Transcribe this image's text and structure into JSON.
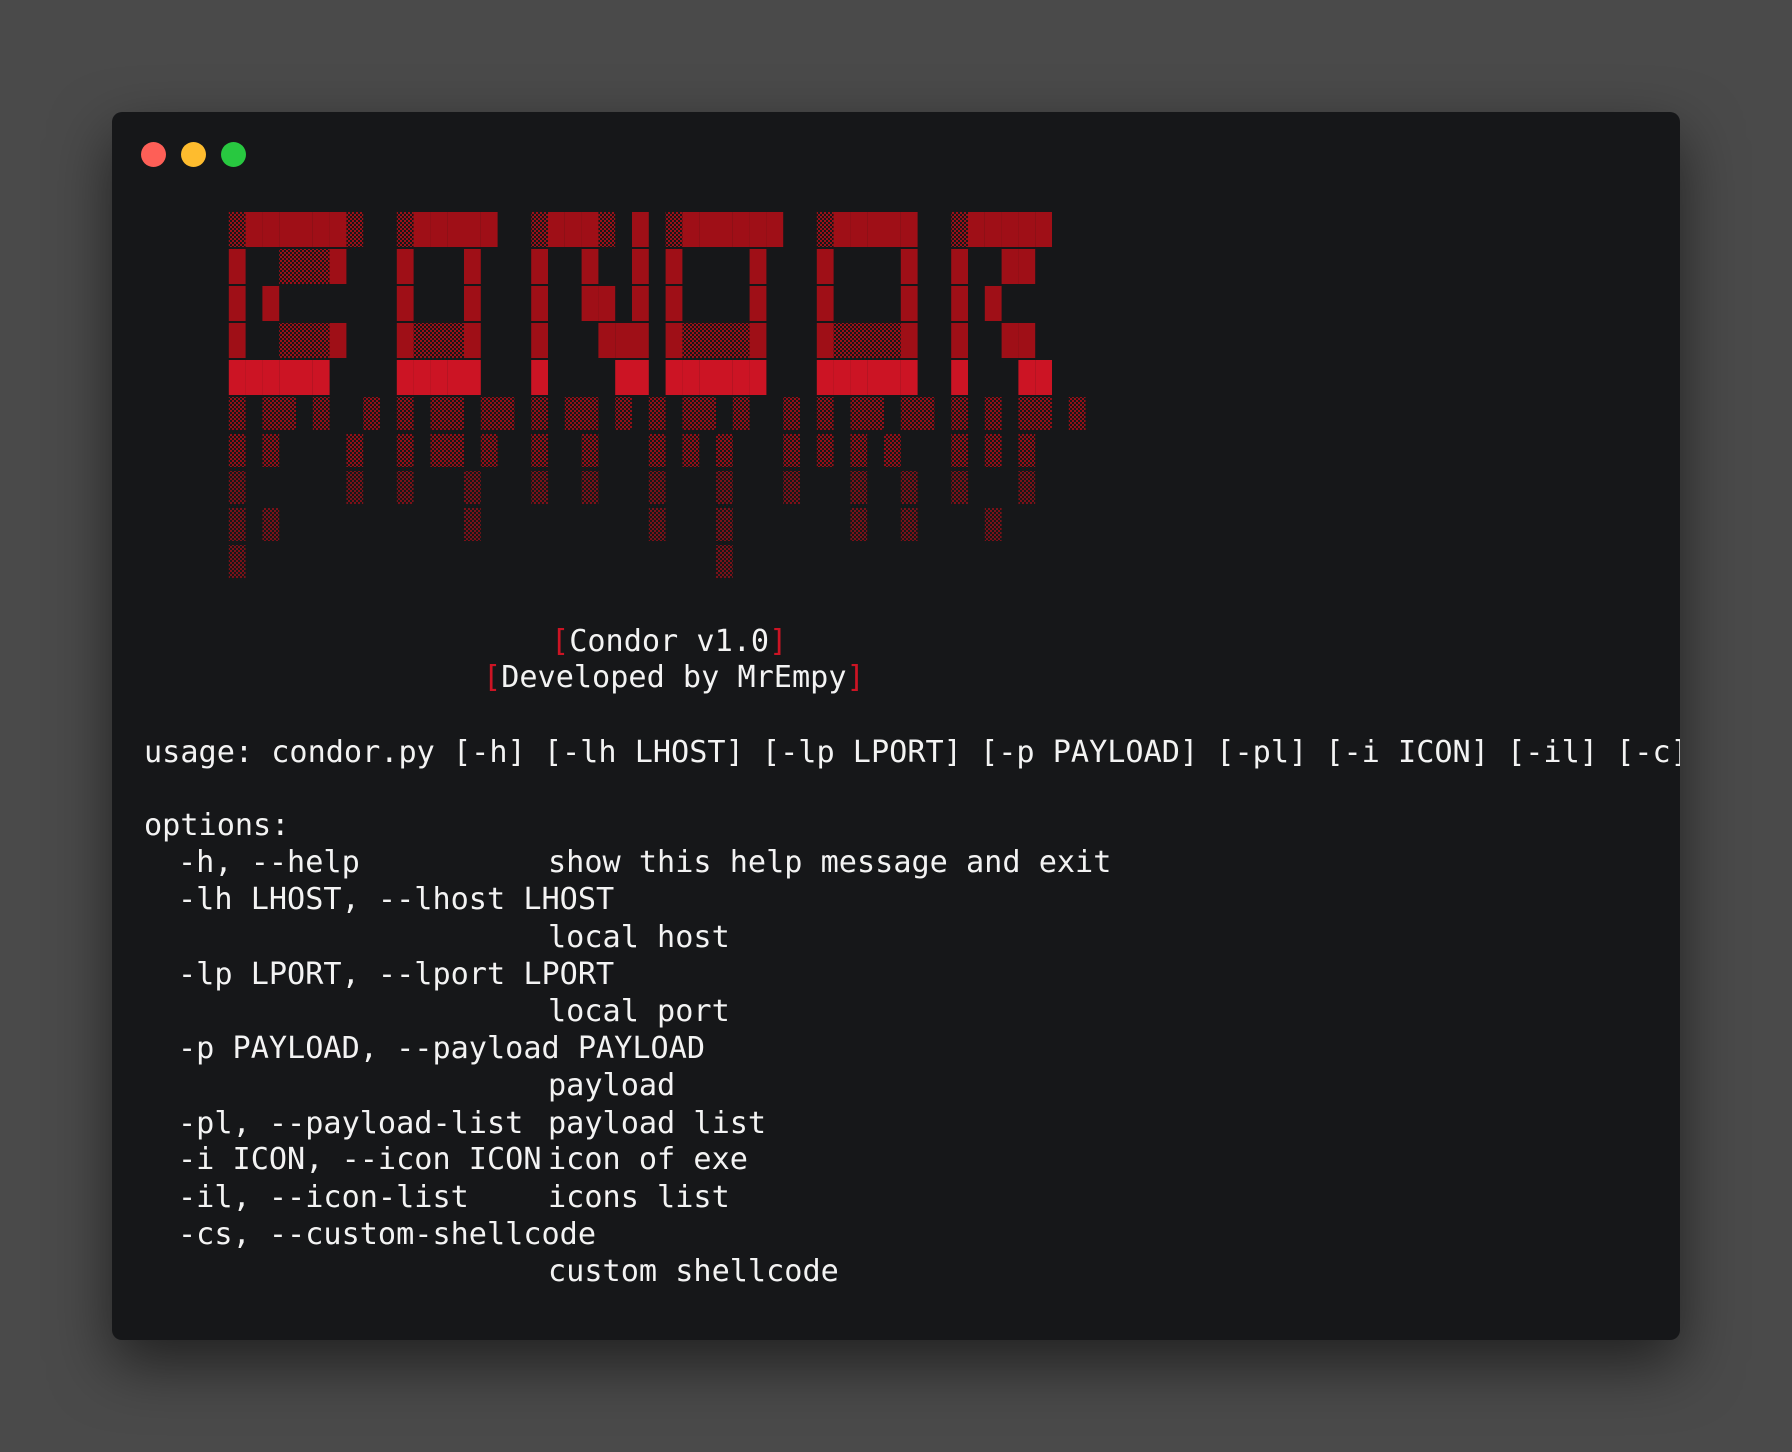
{
  "window": {
    "background": "#161719",
    "controls": [
      {
        "name": "close",
        "color": "#fe5f57"
      },
      {
        "name": "minimize",
        "color": "#febc2e"
      },
      {
        "name": "maximize",
        "color": "#28c840"
      }
    ]
  },
  "banner": {
    "text": "CONDOR",
    "style": "dripping pixel block letters",
    "color": "#cc1424",
    "dark_color": "#9c0f17"
  },
  "title": {
    "open_bracket": "[",
    "close_bracket": "]",
    "name": "Condor v1.0",
    "author": "Developed by MrEmpy"
  },
  "usage": "usage: condor.py [-h] [-lh LHOST] [-lp LPORT] [-p PAYLOAD] [-pl] [-i ICON] [-il] [-c]",
  "options_header": "options:",
  "options": [
    {
      "flag": "-h, --help",
      "desc": "show this help message and exit"
    },
    {
      "flag": "-lh LHOST, --lhost LHOST",
      "desc": "local host"
    },
    {
      "flag": "-lp LPORT, --lport LPORT",
      "desc": "local port"
    },
    {
      "flag": "-p PAYLOAD, --payload PAYLOAD",
      "desc": "payload"
    },
    {
      "flag": "-pl, --payload-list",
      "desc": "payload list"
    },
    {
      "flag": "-i ICON, --icon ICON",
      "desc": "icon of exe"
    },
    {
      "flag": "-il, --icon-list",
      "desc": "icons list"
    },
    {
      "flag": "-cs, --custom-shellcode",
      "desc": "custom shellcode"
    }
  ]
}
